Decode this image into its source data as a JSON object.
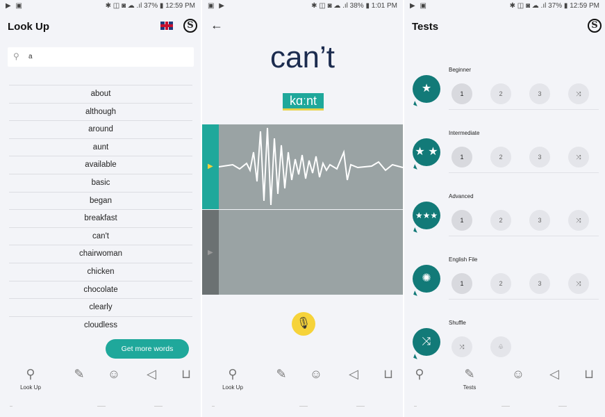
{
  "screens": {
    "lookup": {
      "status": {
        "left": "▶ ▣",
        "right": "✱ ◫ ◙ ☁ .ıl 37% ▮ 12:59 PM"
      },
      "title": "Look Up",
      "logo": "S",
      "search": {
        "value": "a"
      },
      "words": [
        "about",
        "although",
        "around",
        "aunt",
        "available",
        "basic",
        "began",
        "breakfast",
        "can't",
        "chairwoman",
        "chicken",
        "chocolate",
        "clearly",
        "cloudless"
      ],
      "get_more_label": "Get more words",
      "nav": {
        "lookup_label": "Look Up"
      }
    },
    "word": {
      "status": {
        "left": "▣ ▶",
        "right": "✱ ◫ ◙ ☁ .ıl 38% ▮ 1:01 PM"
      },
      "word": "can’t",
      "phonetic": "kɑːnt",
      "nav": {
        "lookup_label": "Look Up"
      }
    },
    "tests": {
      "status": {
        "left": "▶ ▣",
        "right": "✱ ◫ ◙ ☁ .ıl 37% ▮ 12:59 PM"
      },
      "title": "Tests",
      "logo": "S",
      "levels": [
        {
          "name": "Beginner",
          "badge": "★",
          "buttons": [
            "1",
            "2",
            "3",
            "⤨"
          ]
        },
        {
          "name": "Intermediate",
          "badge": "★ ★",
          "buttons": [
            "1",
            "2",
            "3",
            "⤨"
          ]
        },
        {
          "name": "Advanced",
          "badge": "★★★",
          "buttons": [
            "1",
            "2",
            "3",
            "⤨"
          ]
        },
        {
          "name": "English File",
          "badge": "✺",
          "buttons": [
            "1",
            "2",
            "3",
            "⤨"
          ]
        },
        {
          "name": "Shuffle",
          "badge": "⤨",
          "buttons": [
            "⤨",
            "♧"
          ]
        }
      ],
      "nav": {
        "tests_label": "Tests"
      }
    }
  },
  "icons": {
    "search": "search-icon",
    "tests": "tests-icon",
    "pronounce": "pronunciation-icon",
    "sound": "sound-icon",
    "cart": "cart-icon",
    "mic": "microphone-icon",
    "back": "back-arrow-icon"
  },
  "colors": {
    "teal": "#1fa89b",
    "dark_teal": "#127a78",
    "yellow": "#f6d33a",
    "navy": "#1c2c4f"
  }
}
